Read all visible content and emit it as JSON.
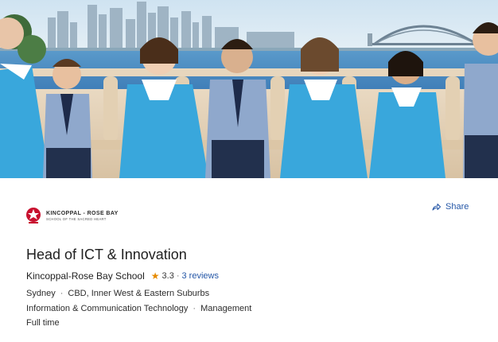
{
  "header": {
    "brand_name": "KINCOPPAL - ROSE BAY",
    "brand_tagline": "SCHOOL OF THE SACRED HEART",
    "share_label": "Share",
    "share_icon": "share-arrow-icon",
    "crest_icon": "school-crest-icon"
  },
  "job": {
    "title": "Head of ICT & Innovation",
    "company": "Kincoppal-Rose Bay School",
    "rating": "3.3",
    "rating_separator": "·",
    "reviews": "3 reviews",
    "locations": [
      "Sydney",
      "CBD, Inner West & Eastern Suburbs"
    ],
    "categories": [
      "Information & Communication Technology",
      "Management"
    ],
    "work_type": "Full time",
    "list_separator": "·"
  },
  "colors": {
    "link": "#2557a7",
    "star": "#e68a00",
    "uniform": "#39a7dc",
    "sky": "#bcd9ec",
    "water": "#4f8fc4"
  }
}
